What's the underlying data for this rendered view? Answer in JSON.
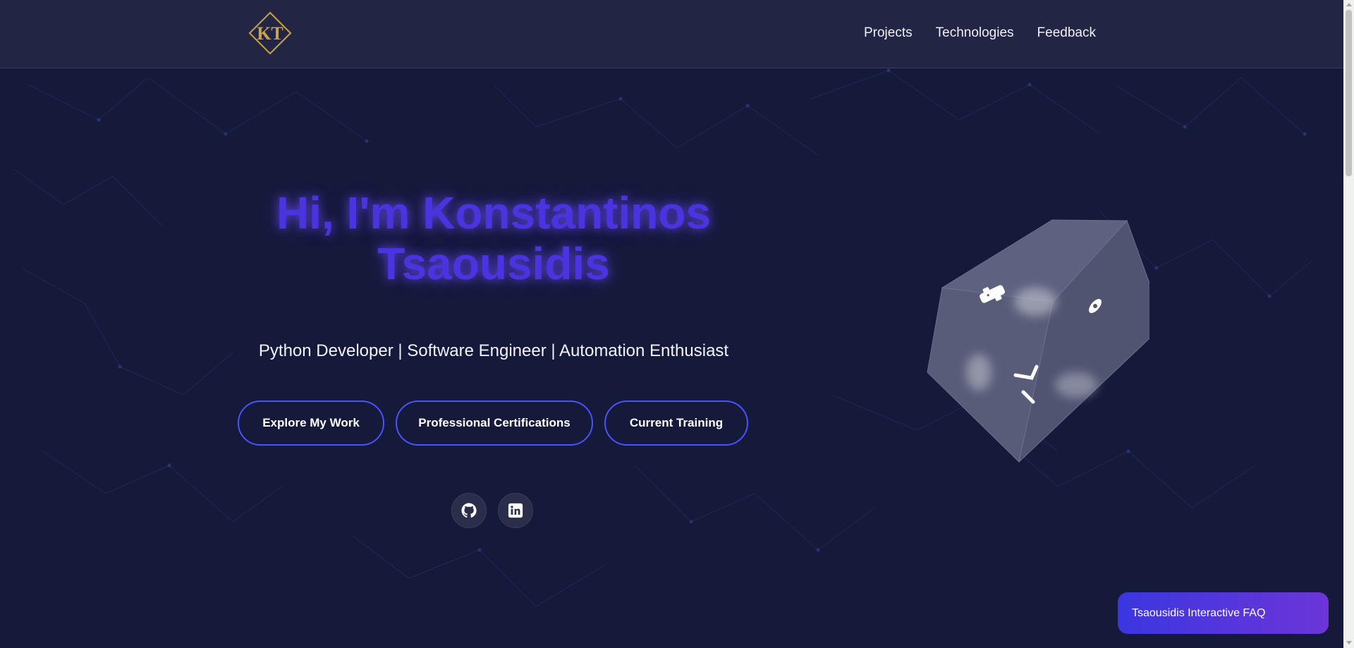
{
  "logo": {
    "text": "KT"
  },
  "nav": {
    "items": [
      "Projects",
      "Technologies",
      "Feedback"
    ]
  },
  "hero": {
    "title_line1": "Hi, I'm Konstantinos",
    "title_line2": "Tsaousidis",
    "subtitle": "Python Developer | Software Engineer | Automation Enthusiast",
    "buttons": [
      "Explore My Work",
      "Professional Certifications",
      "Current Training"
    ]
  },
  "social": {
    "icons": [
      "github-icon",
      "linkedin-icon"
    ]
  },
  "cube": {
    "icons": [
      "python-icon",
      "selenium-icon",
      "openai-icon",
      "ansible-icon"
    ]
  },
  "faq": {
    "label": "Tsaousidis Interactive FAQ"
  },
  "colors": {
    "background": "#161a3a",
    "navbar": "#222644",
    "title": "#4a34e0",
    "button_border": "#4a52ff",
    "faq_gradient_start": "#3b36e0",
    "faq_gradient_end": "#6c35d8",
    "logo_gold": "#c9a24a"
  }
}
